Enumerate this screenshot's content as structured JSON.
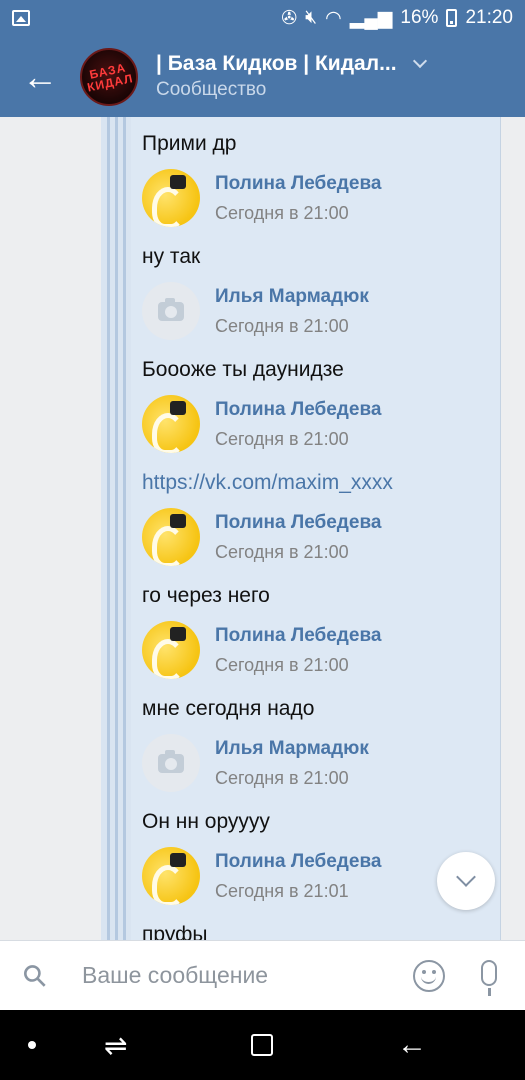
{
  "status": {
    "battery": "16%",
    "time": "21:20"
  },
  "header": {
    "title": "| База Кидков | Кидал...",
    "subtitle": "Сообщество",
    "avatar_text": "БАЗА КИДАЛ"
  },
  "messages": [
    {
      "kind": "text",
      "text": "Прими др"
    },
    {
      "kind": "author",
      "name": "Полина Лебедева",
      "time": "Сегодня в 21:00",
      "avatar": "swan"
    },
    {
      "kind": "text",
      "text": "ну так"
    },
    {
      "kind": "author",
      "name": "Илья Мармадюк",
      "time": "Сегодня в 21:00",
      "avatar": "camera"
    },
    {
      "kind": "text",
      "text": "Бoooже ты даунидзе"
    },
    {
      "kind": "author",
      "name": "Полина Лебедева",
      "time": "Сегодня в 21:00",
      "avatar": "swan"
    },
    {
      "kind": "link",
      "text": "https://vk.com/maxim_xxxx"
    },
    {
      "kind": "author",
      "name": "Полина Лебедева",
      "time": "Сегодня в 21:00",
      "avatar": "swan"
    },
    {
      "kind": "text",
      "text": "го через него"
    },
    {
      "kind": "author",
      "name": "Полина Лебедева",
      "time": "Сегодня в 21:00",
      "avatar": "swan"
    },
    {
      "kind": "text",
      "text": "мне сегодня надо"
    },
    {
      "kind": "author",
      "name": "Илья Мармадюк",
      "time": "Сегодня в 21:00",
      "avatar": "camera"
    },
    {
      "kind": "text",
      "text": "Он нн оруууу"
    },
    {
      "kind": "author",
      "name": "Полина Лебедева",
      "time": "Сегодня в 21:01",
      "avatar": "swan"
    },
    {
      "kind": "text",
      "text": "пруфы"
    }
  ],
  "composer": {
    "placeholder": "Ваше сообщение"
  },
  "icons": {
    "back": "back-arrow-icon",
    "attach": "paperclip-icon",
    "emoji": "smile-icon",
    "mic": "microphone-icon",
    "scroll": "chevron-down-icon"
  },
  "colors": {
    "brand": "#4a76a8",
    "bubble": "#dde8f4",
    "author_name": "#4a76a8",
    "link": "#4a76a8"
  }
}
